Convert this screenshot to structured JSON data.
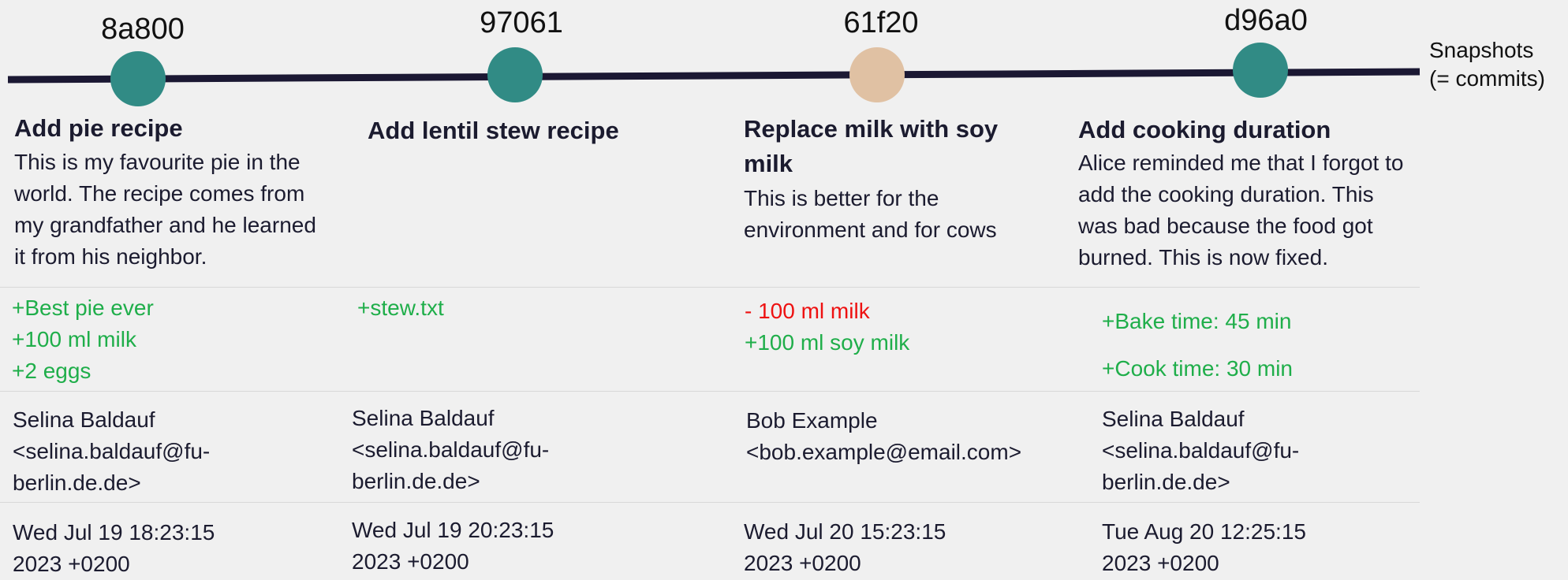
{
  "legend": {
    "line1": "Snapshots",
    "line2": "(= commits)"
  },
  "commits": [
    {
      "hash": "8a800",
      "dot_color": "#318b85",
      "title": "Add pie recipe",
      "description": "This is my favourite pie in the world. The recipe comes from my grandfather and he learned it from his neighbor.",
      "changes": [
        {
          "type": "add",
          "text": "+Best pie ever"
        },
        {
          "type": "add",
          "text": "+100 ml milk"
        },
        {
          "type": "add",
          "text": "+2 eggs"
        }
      ],
      "author_name": "Selina Baldauf",
      "author_email_l1": "<selina.baldauf@fu-",
      "author_email_l2": "berlin.de.de>",
      "date_l1": "Wed Jul 19 18:23:15",
      "date_l2": "2023 +0200"
    },
    {
      "hash": "97061",
      "dot_color": "#318b85",
      "title": "Add lentil stew recipe",
      "description": "",
      "changes": [
        {
          "type": "add",
          "text": "+stew.txt"
        }
      ],
      "author_name": "Selina Baldauf",
      "author_email_l1": "<selina.baldauf@fu-",
      "author_email_l2": "berlin.de.de>",
      "date_l1": "Wed Jul 19 20:23:15",
      "date_l2": "2023 +0200"
    },
    {
      "hash": "61f20",
      "dot_color": "#e0c1a3",
      "title": "Replace milk with soy milk",
      "description": "This is better for the environment and for cows",
      "changes": [
        {
          "type": "del",
          "text": "- 100 ml milk"
        },
        {
          "type": "add",
          "text": "+100 ml soy milk"
        }
      ],
      "author_name": "Bob Example",
      "author_email_l1": "<bob.example@email.com>",
      "author_email_l2": "",
      "date_l1": "Wed Jul 20 15:23:15",
      "date_l2": "2023 +0200"
    },
    {
      "hash": "d96a0",
      "dot_color": "#318b85",
      "title": "Add cooking duration",
      "description": "Alice reminded me that I forgot to add the cooking duration. This was bad because the food got burned. This is now fixed.",
      "changes": [
        {
          "type": "add",
          "text": "+Bake time: 45 min"
        },
        {
          "type": "add",
          "text": "+Cook time: 30 min"
        }
      ],
      "author_name": "Selina Baldauf",
      "author_email_l1": "<selina.baldauf@fu-",
      "author_email_l2": "berlin.de.de>",
      "date_l1": "Tue Aug 20 12:25:15",
      "date_l2": "2023 +0200"
    }
  ]
}
